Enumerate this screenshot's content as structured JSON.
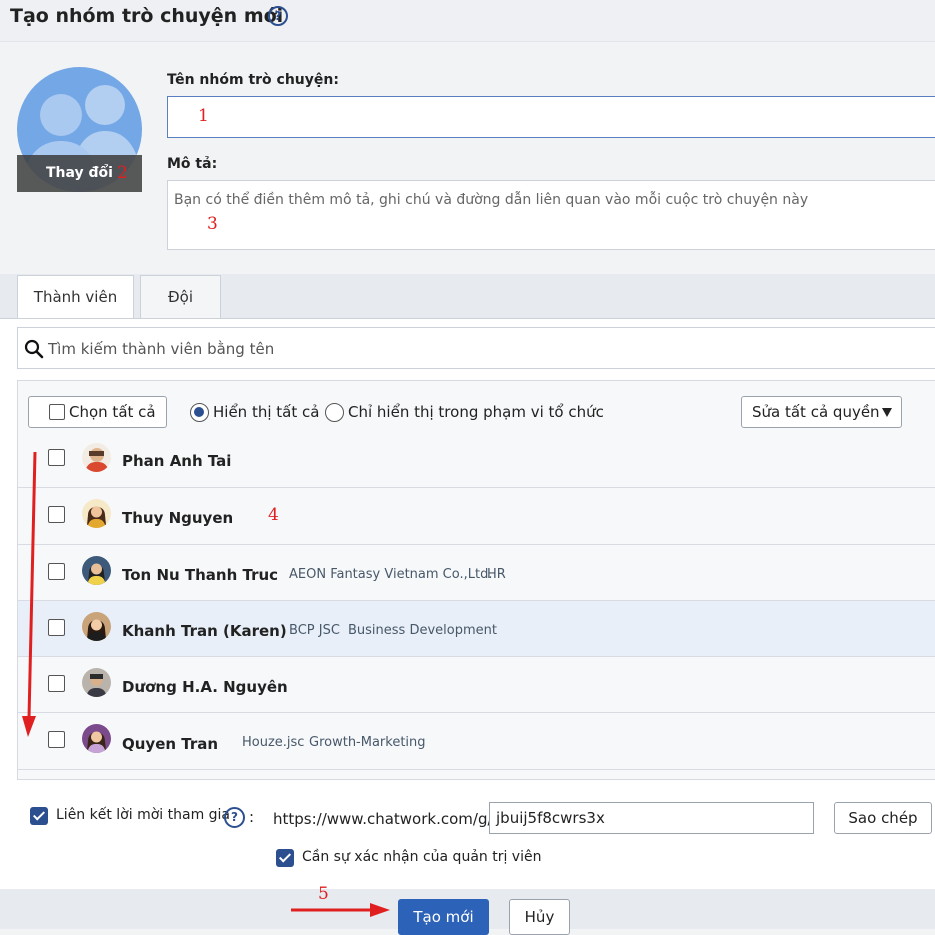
{
  "header": {
    "title": "Tạo nhóm trò chuyện mới",
    "help_icon": "question-circle-icon",
    "help_glyph": "?"
  },
  "avatar": {
    "change_label": "Thay đổi"
  },
  "form": {
    "name_label": "Tên nhóm trò chuyện:",
    "name_value": "",
    "description_label": "Mô tả:",
    "description_placeholder": "Bạn có thể điền thêm mô tả, ghi chú và đường dẫn liên quan vào mỗi cuộc trò chuyện này"
  },
  "tabs": [
    {
      "label": "Thành viên",
      "active": true
    },
    {
      "label": "Đội",
      "active": false
    }
  ],
  "search": {
    "placeholder": "Tìm kiếm thành viên bằng tên",
    "icon": "search-icon"
  },
  "filters": {
    "select_all_label": "Chọn tất cả",
    "show_all_label": "Hiển thị tất cả",
    "show_org_label": "Chỉ hiển thị trong phạm vi tổ chức",
    "selected_filter": "show_all",
    "edit_permissions_label": "Sửa tất cả quyền"
  },
  "members": [
    {
      "name": "Phan Anh Tai",
      "org": "",
      "dept": "",
      "checked": false
    },
    {
      "name": "Thuy Nguyen",
      "org": "",
      "dept": "",
      "checked": false
    },
    {
      "name": "Ton Nu Thanh Truc",
      "org": "AEON Fantasy Vietnam Co.,Ltd.",
      "dept": "HR",
      "checked": false
    },
    {
      "name": "Khanh Tran (Karen)",
      "org": "BCP JSC",
      "dept": "Business Development",
      "checked": false,
      "highlighted": true
    },
    {
      "name": "Dương H.A. Nguyên",
      "org": "",
      "dept": "",
      "checked": false
    },
    {
      "name": "Quyen Tran",
      "org": "Houze.jsc",
      "dept": "Growth-Marketing",
      "checked": false
    }
  ],
  "invite": {
    "enabled": true,
    "label": "Liên kết lời mời tham gia",
    "colon": ":",
    "base_url": "https://www.chatwork.com/g/",
    "code": "jbuij5f8cwrs3x",
    "copy_label": "Sao chép",
    "admin_approval_label": "Cần sự xác nhận của quản trị viên",
    "admin_approval": true
  },
  "actions": {
    "create_label": "Tạo mới",
    "cancel_label": "Hủy"
  },
  "annotations": [
    "1",
    "2",
    "3",
    "4",
    "5"
  ],
  "colors": {
    "primary": "#2c62b7",
    "accent_dark": "#2c4f8f",
    "annotation": "#e02020",
    "avatar_bg": "#74a7e5"
  }
}
